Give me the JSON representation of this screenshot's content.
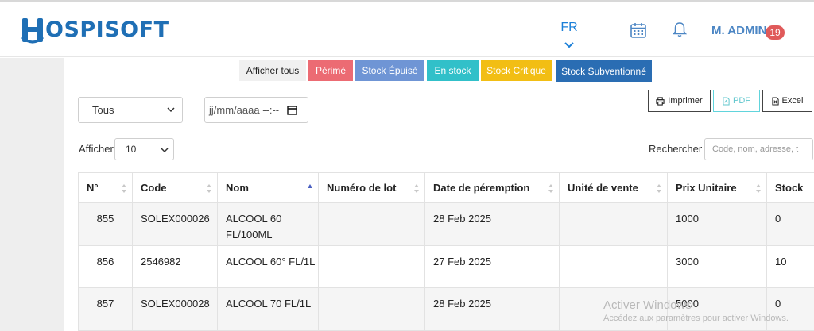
{
  "app": {
    "logo_text": "OSPISOFT",
    "logo_color": "#1f6fb5"
  },
  "header": {
    "language": "FR",
    "user_name": "M. ADMIN",
    "notification_count": "19"
  },
  "filters": [
    {
      "label": "Afficher tous",
      "color": "#f0f0f0"
    },
    {
      "label": "Périmé",
      "color": "#ec6b73"
    },
    {
      "label": "Stock Épuisé",
      "color": "#6f95d5"
    },
    {
      "label": "En stock",
      "color": "#31c0c9"
    },
    {
      "label": "Stock Critique",
      "color": "#f2be14"
    },
    {
      "label": "Stock Subventionné",
      "color": "#2a6db3"
    }
  ],
  "controls": {
    "category_select": "Tous",
    "date_placeholder": "jj/mm/aaaa --:--",
    "show_label": "Afficher",
    "page_length": "10",
    "search_label": "Rechercher",
    "search_placeholder": "Code, nom, adresse, t"
  },
  "export": {
    "print": "Imprimer",
    "pdf": "PDF",
    "excel": "Excel"
  },
  "table": {
    "columns": [
      "N°",
      "Code",
      "Nom",
      "Numéro de lot",
      "Date de péremption",
      "Unité de vente",
      "Prix Unitaire",
      "Stock"
    ],
    "rows": [
      {
        "n": "855",
        "code": "SOLEX000026",
        "nom": "ALCOOL 60 FL/100ML",
        "lot": "",
        "date": "28 Feb 2025",
        "unite": "",
        "prix": "1000",
        "stock": "0"
      },
      {
        "n": "856",
        "code": "2546982",
        "nom": "ALCOOL 60° FL/1L",
        "lot": "",
        "date": "27 Feb 2025",
        "unite": "",
        "prix": "3000",
        "stock": "10"
      },
      {
        "n": "857",
        "code": "SOLEX000028",
        "nom": "ALCOOL 70 FL/1L",
        "lot": "",
        "date": "28 Feb 2025",
        "unite": "",
        "prix": "5000",
        "stock": "0"
      }
    ]
  },
  "watermark": {
    "title": "Activer Windows",
    "subtitle": "Accédez aux paramètres pour activer Windows."
  }
}
